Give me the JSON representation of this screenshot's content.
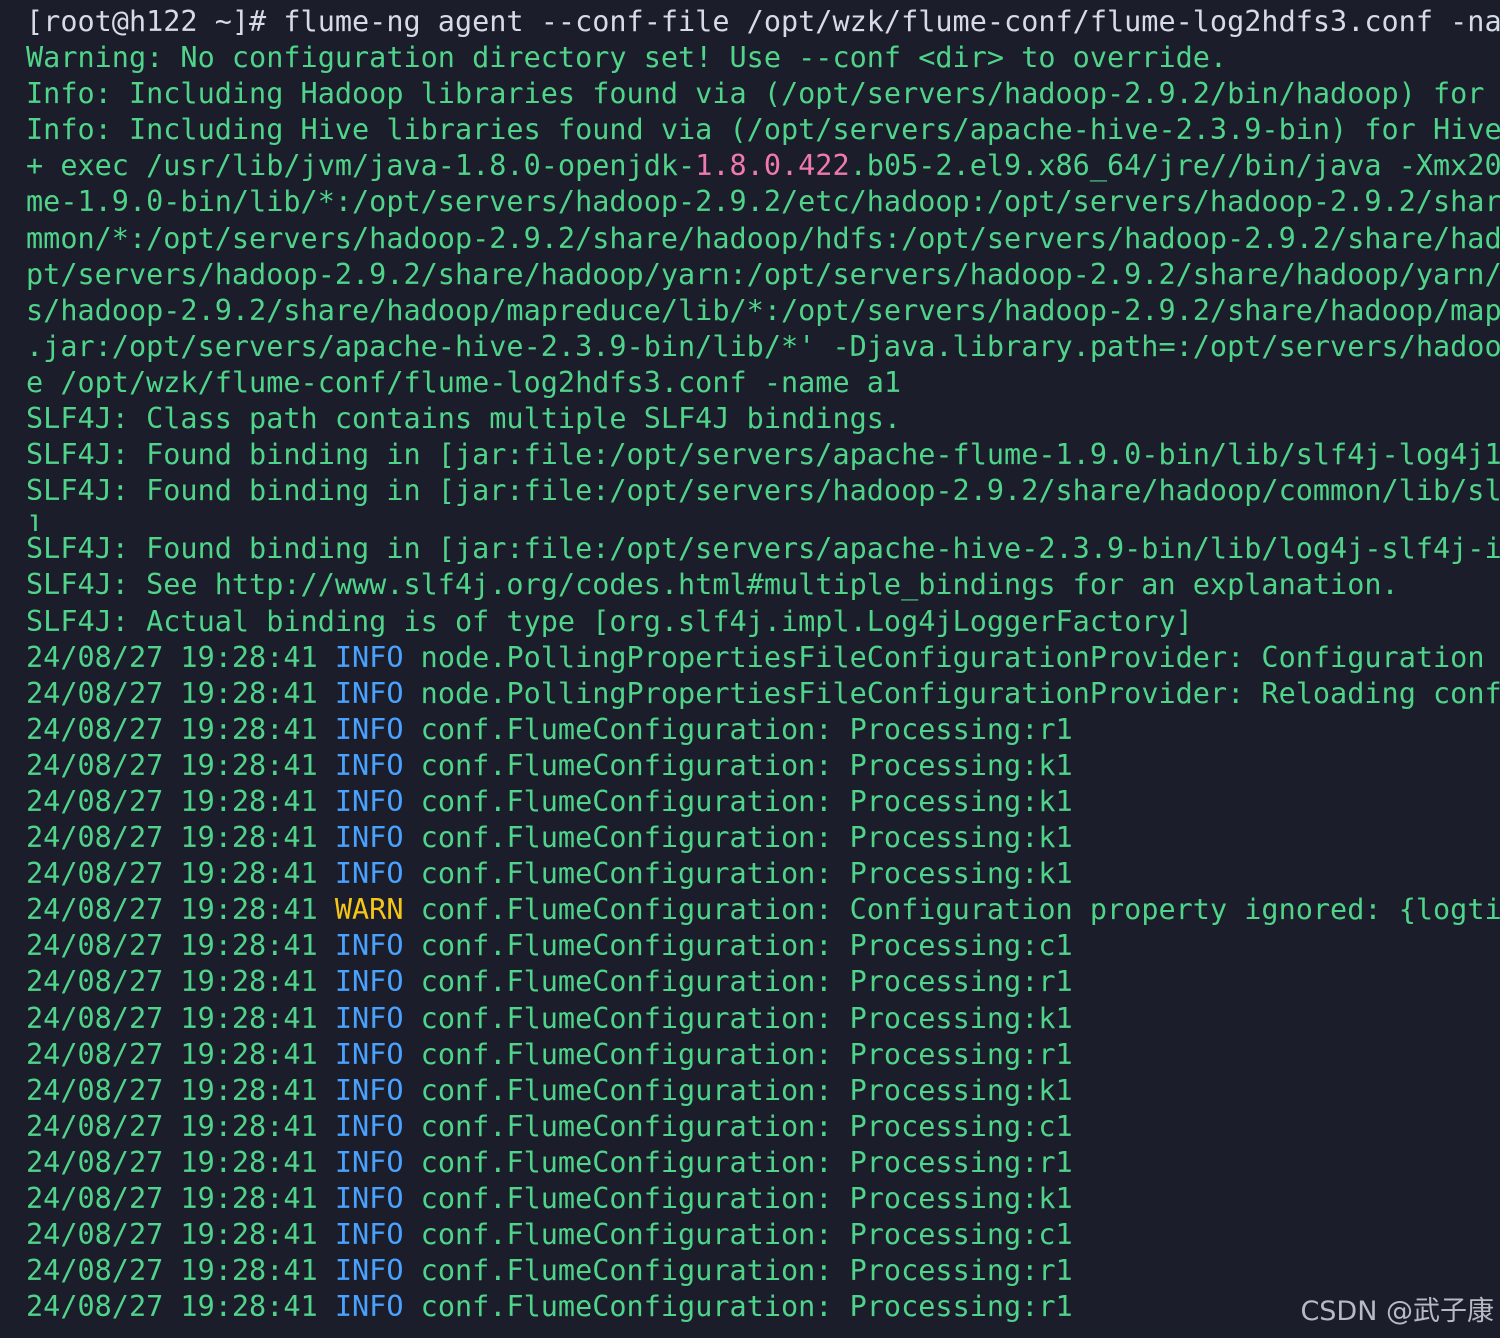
{
  "colors": {
    "background": "#1b1d2b",
    "prompt": "#d7dbe6",
    "text": "#4fd48a",
    "number_highlight": "#f07ab0",
    "info": "#4aa2ff",
    "warn": "#f5c518"
  },
  "terminal": {
    "lines": [
      {
        "kind": "prompt",
        "segments": [
          {
            "type": "prompt",
            "text": "[root@h122 ~]# flume-ng agent --conf-file /opt/wzk/flume-conf/flume-log2hdfs3.conf -na"
          }
        ]
      },
      {
        "kind": "plain",
        "segments": [
          {
            "type": "text",
            "text": "Warning: No configuration directory set! Use --conf <dir> to override."
          }
        ]
      },
      {
        "kind": "plain",
        "segments": [
          {
            "type": "text",
            "text": "Info: Including Hadoop libraries found via (/opt/servers/hadoop-2.9.2/bin/hadoop) for"
          }
        ]
      },
      {
        "kind": "plain",
        "segments": [
          {
            "type": "text",
            "text": "Info: Including Hive libraries found via (/opt/servers/apache-hive-2.3.9-bin) for Hive"
          }
        ]
      },
      {
        "kind": "plain",
        "segments": [
          {
            "type": "text",
            "text": "+ exec /usr/lib/jvm/java-1.8.0-openjdk-"
          },
          {
            "type": "number",
            "text": "1.8.0.422"
          },
          {
            "type": "text",
            "text": ".b05-2.el9.x86_64/jre//bin/java -Xmx20"
          }
        ]
      },
      {
        "kind": "plain",
        "segments": [
          {
            "type": "text",
            "text": "me-1.9.0-bin/lib/*:/opt/servers/hadoop-2.9.2/etc/hadoop:/opt/servers/hadoop-2.9.2/shar"
          }
        ]
      },
      {
        "kind": "plain",
        "segments": [
          {
            "type": "text",
            "text": "mmon/*:/opt/servers/hadoop-2.9.2/share/hadoop/hdfs:/opt/servers/hadoop-2.9.2/share/had"
          }
        ]
      },
      {
        "kind": "plain",
        "segments": [
          {
            "type": "text",
            "text": "pt/servers/hadoop-2.9.2/share/hadoop/yarn:/opt/servers/hadoop-2.9.2/share/hadoop/yarn/"
          }
        ]
      },
      {
        "kind": "plain",
        "segments": [
          {
            "type": "text",
            "text": "s/hadoop-2.9.2/share/hadoop/mapreduce/lib/*:/opt/servers/hadoop-2.9.2/share/hadoop/map"
          }
        ]
      },
      {
        "kind": "plain",
        "segments": [
          {
            "type": "text",
            "text": ".jar:/opt/servers/apache-hive-2.3.9-bin/lib/*' -Djava.library.path=:/opt/servers/hadoo"
          }
        ]
      },
      {
        "kind": "plain",
        "segments": [
          {
            "type": "text",
            "text": "e /opt/wzk/flume-conf/flume-log2hdfs3.conf -name a1"
          }
        ]
      },
      {
        "kind": "plain",
        "segments": [
          {
            "type": "text",
            "text": "SLF4J: Class path contains multiple SLF4J bindings."
          }
        ]
      },
      {
        "kind": "plain",
        "segments": [
          {
            "type": "text",
            "text": "SLF4J: Found binding in [jar:file:/opt/servers/apache-flume-1.9.0-bin/lib/slf4j-log4j1"
          }
        ]
      },
      {
        "kind": "plain",
        "segments": [
          {
            "type": "text",
            "text": "SLF4J: Found binding in [jar:file:/opt/servers/hadoop-2.9.2/share/hadoop/common/lib/sl"
          }
        ]
      },
      {
        "kind": "wrap",
        "segments": [
          {
            "type": "text",
            "text": "]"
          }
        ]
      },
      {
        "kind": "plain",
        "segments": [
          {
            "type": "text",
            "text": "SLF4J: Found binding in [jar:file:/opt/servers/apache-hive-2.3.9-bin/lib/log4j-slf4j-i"
          }
        ]
      },
      {
        "kind": "plain",
        "segments": [
          {
            "type": "text",
            "text": "SLF4J: See http://www.slf4j.org/codes.html#multiple_bindings for an explanation."
          }
        ]
      },
      {
        "kind": "plain",
        "segments": [
          {
            "type": "text",
            "text": "SLF4J: Actual binding is of type [org.slf4j.impl.Log4jLoggerFactory]"
          }
        ]
      },
      {
        "kind": "log",
        "segments": [
          {
            "type": "ts",
            "text": "24/08/27 19:28:41 "
          },
          {
            "type": "info",
            "text": "INFO"
          },
          {
            "type": "text",
            "text": " node.PollingPropertiesFileConfigurationProvider: Configuration"
          }
        ]
      },
      {
        "kind": "log",
        "segments": [
          {
            "type": "ts",
            "text": "24/08/27 19:28:41 "
          },
          {
            "type": "info",
            "text": "INFO"
          },
          {
            "type": "text",
            "text": " node.PollingPropertiesFileConfigurationProvider: Reloading conf"
          }
        ]
      },
      {
        "kind": "log",
        "segments": [
          {
            "type": "ts",
            "text": "24/08/27 19:28:41 "
          },
          {
            "type": "info",
            "text": "INFO"
          },
          {
            "type": "text",
            "text": " conf.FlumeConfiguration: Processing:r1"
          }
        ]
      },
      {
        "kind": "log",
        "segments": [
          {
            "type": "ts",
            "text": "24/08/27 19:28:41 "
          },
          {
            "type": "info",
            "text": "INFO"
          },
          {
            "type": "text",
            "text": " conf.FlumeConfiguration: Processing:k1"
          }
        ]
      },
      {
        "kind": "log",
        "segments": [
          {
            "type": "ts",
            "text": "24/08/27 19:28:41 "
          },
          {
            "type": "info",
            "text": "INFO"
          },
          {
            "type": "text",
            "text": " conf.FlumeConfiguration: Processing:k1"
          }
        ]
      },
      {
        "kind": "log",
        "segments": [
          {
            "type": "ts",
            "text": "24/08/27 19:28:41 "
          },
          {
            "type": "info",
            "text": "INFO"
          },
          {
            "type": "text",
            "text": " conf.FlumeConfiguration: Processing:k1"
          }
        ]
      },
      {
        "kind": "log",
        "segments": [
          {
            "type": "ts",
            "text": "24/08/27 19:28:41 "
          },
          {
            "type": "info",
            "text": "INFO"
          },
          {
            "type": "text",
            "text": " conf.FlumeConfiguration: Processing:k1"
          }
        ]
      },
      {
        "kind": "log",
        "segments": [
          {
            "type": "ts",
            "text": "24/08/27 19:28:41 "
          },
          {
            "type": "warn",
            "text": "WARN"
          },
          {
            "type": "text",
            "text": " conf.FlumeConfiguration: Configuration property ignored: {logti"
          }
        ]
      },
      {
        "kind": "log",
        "segments": [
          {
            "type": "ts",
            "text": "24/08/27 19:28:41 "
          },
          {
            "type": "info",
            "text": "INFO"
          },
          {
            "type": "text",
            "text": " conf.FlumeConfiguration: Processing:c1"
          }
        ]
      },
      {
        "kind": "log",
        "segments": [
          {
            "type": "ts",
            "text": "24/08/27 19:28:41 "
          },
          {
            "type": "info",
            "text": "INFO"
          },
          {
            "type": "text",
            "text": " conf.FlumeConfiguration: Processing:r1"
          }
        ]
      },
      {
        "kind": "log",
        "segments": [
          {
            "type": "ts",
            "text": "24/08/27 19:28:41 "
          },
          {
            "type": "info",
            "text": "INFO"
          },
          {
            "type": "text",
            "text": " conf.FlumeConfiguration: Processing:k1"
          }
        ]
      },
      {
        "kind": "log",
        "segments": [
          {
            "type": "ts",
            "text": "24/08/27 19:28:41 "
          },
          {
            "type": "info",
            "text": "INFO"
          },
          {
            "type": "text",
            "text": " conf.FlumeConfiguration: Processing:r1"
          }
        ]
      },
      {
        "kind": "log",
        "segments": [
          {
            "type": "ts",
            "text": "24/08/27 19:28:41 "
          },
          {
            "type": "info",
            "text": "INFO"
          },
          {
            "type": "text",
            "text": " conf.FlumeConfiguration: Processing:k1"
          }
        ]
      },
      {
        "kind": "log",
        "segments": [
          {
            "type": "ts",
            "text": "24/08/27 19:28:41 "
          },
          {
            "type": "info",
            "text": "INFO"
          },
          {
            "type": "text",
            "text": " conf.FlumeConfiguration: Processing:c1"
          }
        ]
      },
      {
        "kind": "log",
        "segments": [
          {
            "type": "ts",
            "text": "24/08/27 19:28:41 "
          },
          {
            "type": "info",
            "text": "INFO"
          },
          {
            "type": "text",
            "text": " conf.FlumeConfiguration: Processing:r1"
          }
        ]
      },
      {
        "kind": "log",
        "segments": [
          {
            "type": "ts",
            "text": "24/08/27 19:28:41 "
          },
          {
            "type": "info",
            "text": "INFO"
          },
          {
            "type": "text",
            "text": " conf.FlumeConfiguration: Processing:k1"
          }
        ]
      },
      {
        "kind": "log",
        "segments": [
          {
            "type": "ts",
            "text": "24/08/27 19:28:41 "
          },
          {
            "type": "info",
            "text": "INFO"
          },
          {
            "type": "text",
            "text": " conf.FlumeConfiguration: Processing:c1"
          }
        ]
      },
      {
        "kind": "log",
        "segments": [
          {
            "type": "ts",
            "text": "24/08/27 19:28:41 "
          },
          {
            "type": "info",
            "text": "INFO"
          },
          {
            "type": "text",
            "text": " conf.FlumeConfiguration: Processing:r1"
          }
        ]
      },
      {
        "kind": "log",
        "segments": [
          {
            "type": "ts",
            "text": "24/08/27 19:28:41 "
          },
          {
            "type": "info",
            "text": "INFO"
          },
          {
            "type": "text",
            "text": " conf.FlumeConfiguration: Processing:r1"
          }
        ]
      }
    ]
  },
  "watermark": {
    "text": "CSDN @武子康"
  }
}
